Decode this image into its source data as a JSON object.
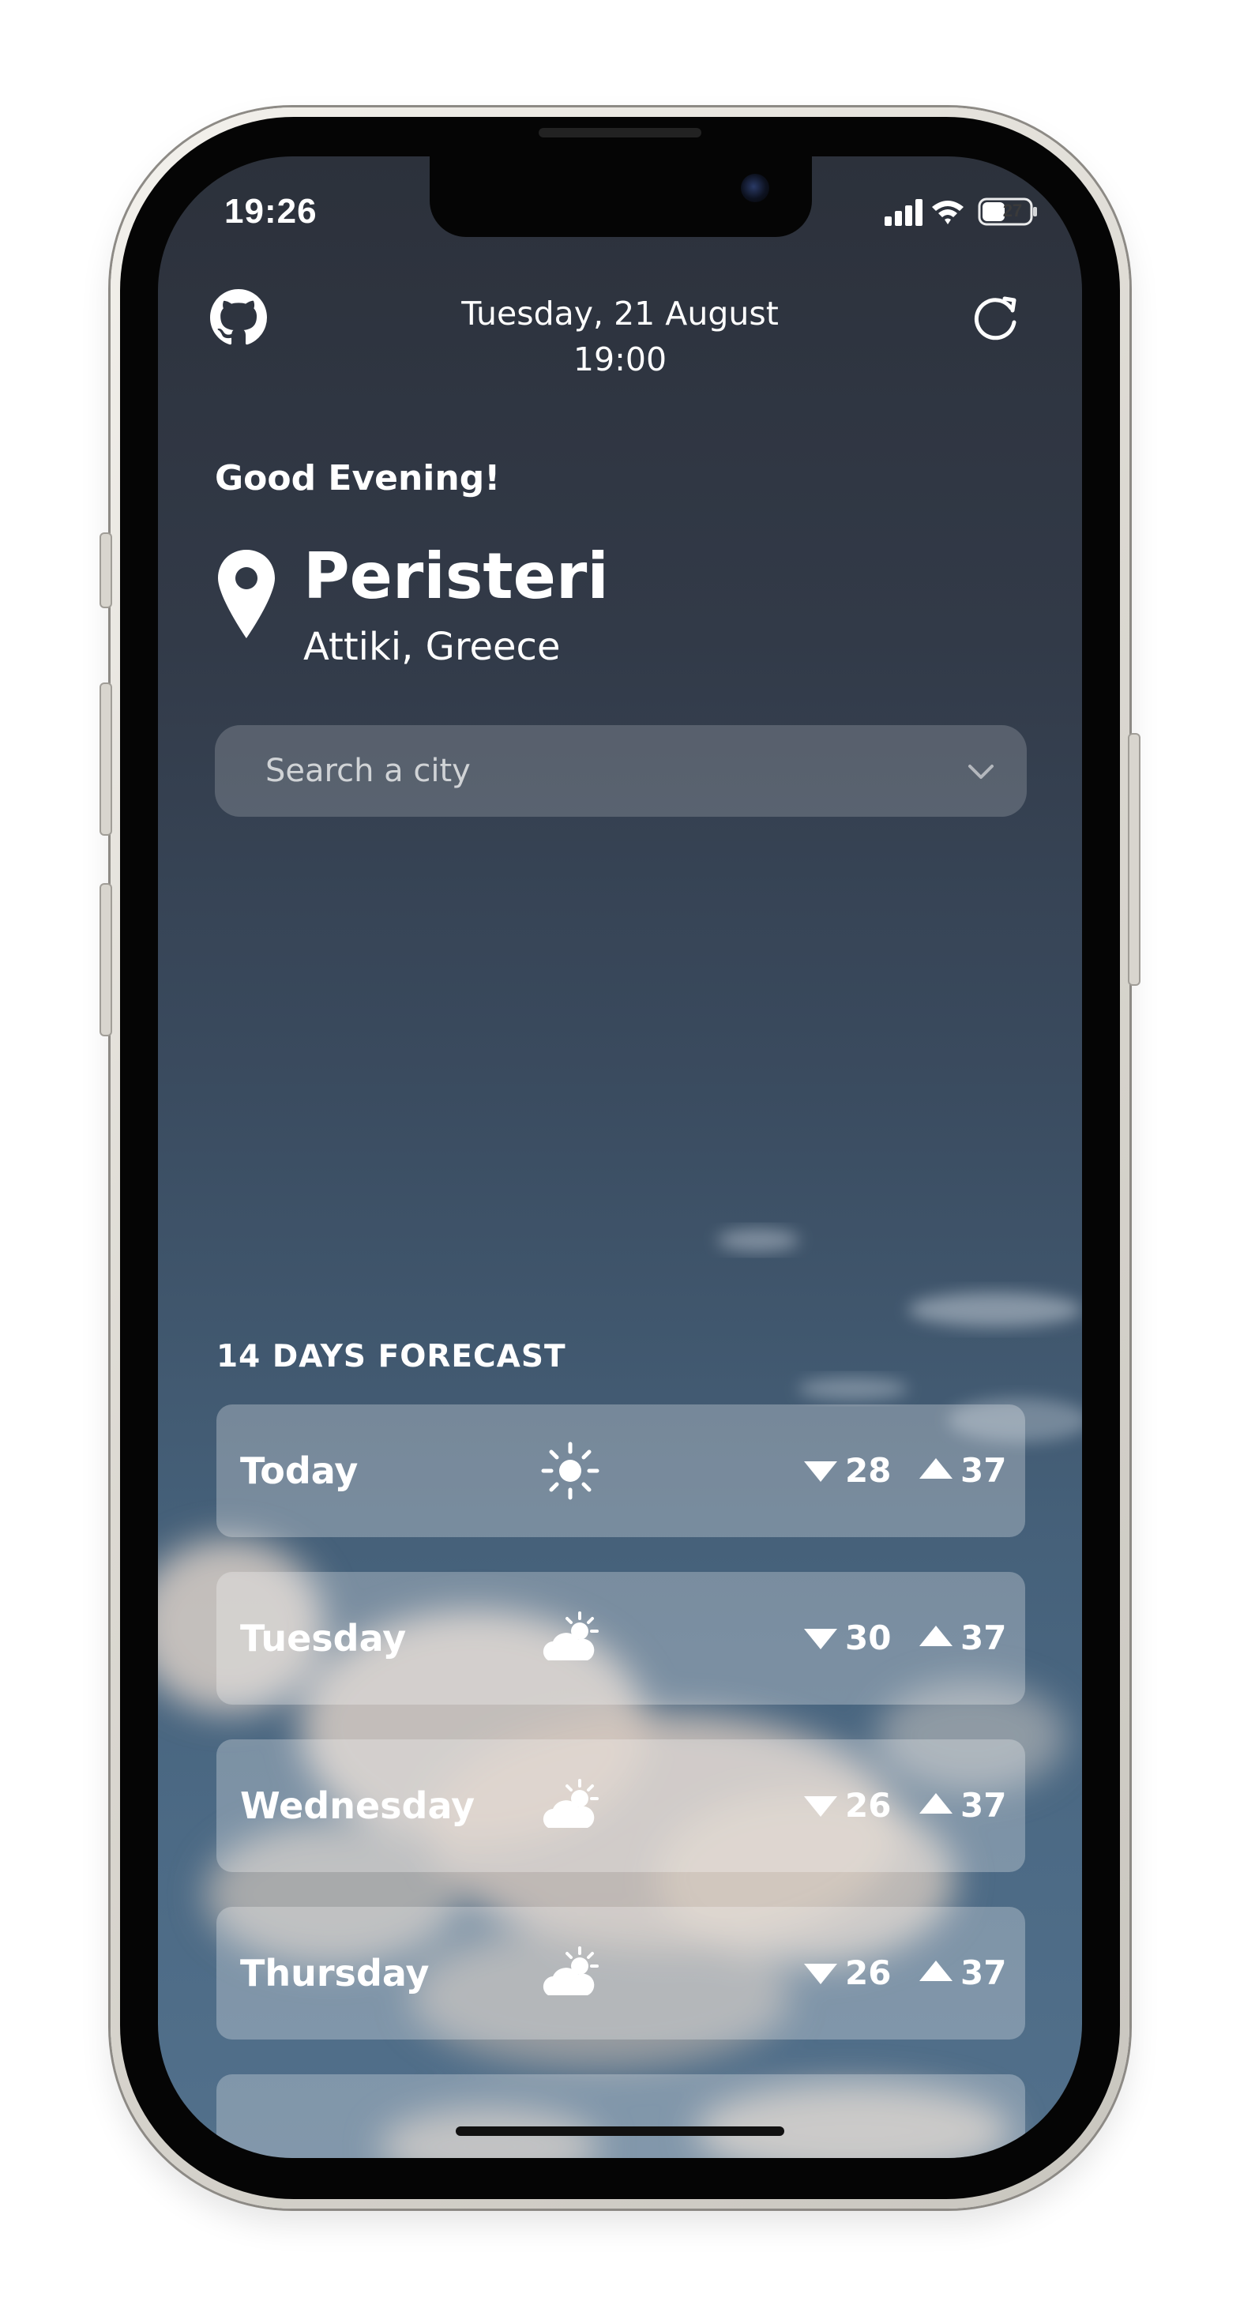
{
  "status_bar": {
    "time": "19:26",
    "battery": "27",
    "icons": [
      "cellular-signal-icon",
      "wifi-icon",
      "battery-icon"
    ]
  },
  "header": {
    "date_line": "Tuesday, 21 August",
    "time_line": "19:00",
    "left_icon": "github-icon",
    "right_icon": "refresh-icon"
  },
  "greeting": "Good Evening!",
  "location": {
    "city": "Peristeri",
    "region": "Attiki, Greece",
    "icon": "map-pin-icon"
  },
  "search": {
    "placeholder": "Search a city",
    "icon": "chevron-down-icon"
  },
  "forecast": {
    "title": "14 DAYS FORECAST",
    "days": [
      {
        "day": "Today",
        "icon": "sun-icon",
        "min": "28",
        "max": "37"
      },
      {
        "day": "Tuesday",
        "icon": "partly-cloudy-icon",
        "min": "30",
        "max": "37"
      },
      {
        "day": "Wednesday",
        "icon": "partly-cloudy-icon",
        "min": "26",
        "max": "37"
      },
      {
        "day": "Thursday",
        "icon": "partly-cloudy-icon",
        "min": "26",
        "max": "37"
      }
    ]
  },
  "colors": {
    "background_top": "#2c313b",
    "background_bottom": "#52708b",
    "card": "rgba(255,255,255,0.28)",
    "text": "#ffffff"
  }
}
